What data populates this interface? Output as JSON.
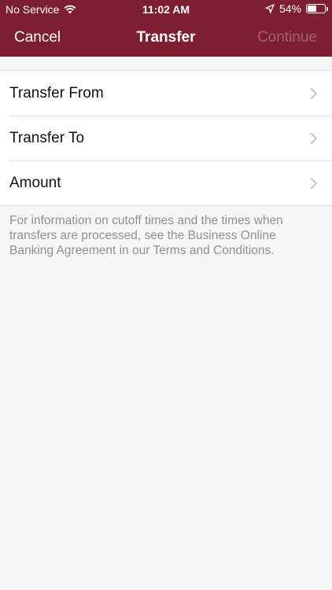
{
  "status_bar": {
    "carrier": "No Service",
    "time": "11:02 AM",
    "battery": "54%",
    "battery_level": 0.54,
    "icons": [
      "wifi-icon",
      "location-arrow-icon",
      "battery-icon"
    ]
  },
  "nav": {
    "cancel_label": "Cancel",
    "title": "Transfer",
    "continue_label": "Continue"
  },
  "rows": [
    {
      "label": "Transfer From"
    },
    {
      "label": "Transfer To"
    },
    {
      "label": "Amount"
    }
  ],
  "footnote": "For information on cutoff times and the times when transfers are processed, see the Business Online Banking Agreement in our Terms and Conditions.",
  "colors": {
    "header": "#7d1f30",
    "continue_disabled": "#a3606c",
    "background": "#f6f6f6",
    "footnote_text": "#909090"
  }
}
